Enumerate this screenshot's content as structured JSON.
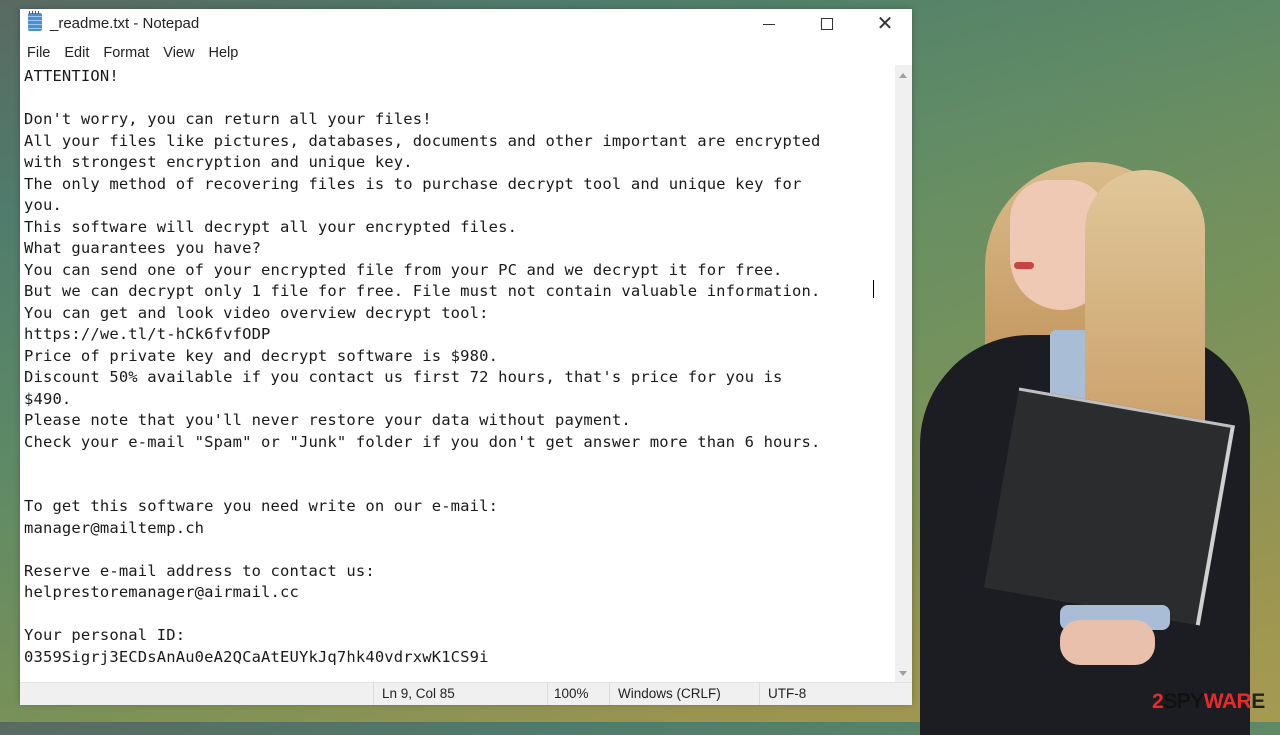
{
  "window": {
    "title": "_readme.txt - Notepad",
    "icon": "notepad-icon",
    "controls": {
      "minimize": "minimize-icon",
      "maximize": "maximize-icon",
      "close": "close-icon",
      "close_glyph": "✕"
    }
  },
  "menu": {
    "items": [
      {
        "label": "File"
      },
      {
        "label": "Edit"
      },
      {
        "label": "Format"
      },
      {
        "label": "View"
      },
      {
        "label": "Help"
      }
    ]
  },
  "document": {
    "lines": [
      "ATTENTION!",
      "",
      "Don't worry, you can return all your files!",
      "All your files like pictures, databases, documents and other important are encrypted",
      "with strongest encryption and unique key.",
      "The only method of recovering files is to purchase decrypt tool and unique key for",
      "you.",
      "This software will decrypt all your encrypted files.",
      "What guarantees you have?",
      "You can send one of your encrypted file from your PC and we decrypt it for free.",
      "But we can decrypt only 1 file for free. File must not contain valuable information.",
      "You can get and look video overview decrypt tool:",
      "https://we.tl/t-hCk6fvfODP",
      "Price of private key and decrypt software is $980.",
      "Discount 50% available if you contact us first 72 hours, that's price for you is",
      "$490.",
      "Please note that you'll never restore your data without payment.",
      "Check your e-mail \"Spam\" or \"Junk\" folder if you don't get answer more than 6 hours.",
      "",
      "",
      "To get this software you need write on our e-mail:",
      "manager@mailtemp.ch",
      "",
      "Reserve e-mail address to contact us:",
      "helprestoremanager@airmail.cc",
      "",
      "Your personal ID:",
      "0359Sigrj3ECDsAnAu0eA2QCaAtEUYkJq7hk40vdrxwK1CS9i"
    ]
  },
  "statusbar": {
    "position": "Ln 9, Col 85",
    "zoom": "100%",
    "line_ending": "Windows (CRLF)",
    "encoding": "UTF-8"
  },
  "watermark": {
    "part1": "2",
    "part2": "SPY",
    "part3": "WAR",
    "part4": "E",
    "accent_color": "#e52b2b"
  }
}
